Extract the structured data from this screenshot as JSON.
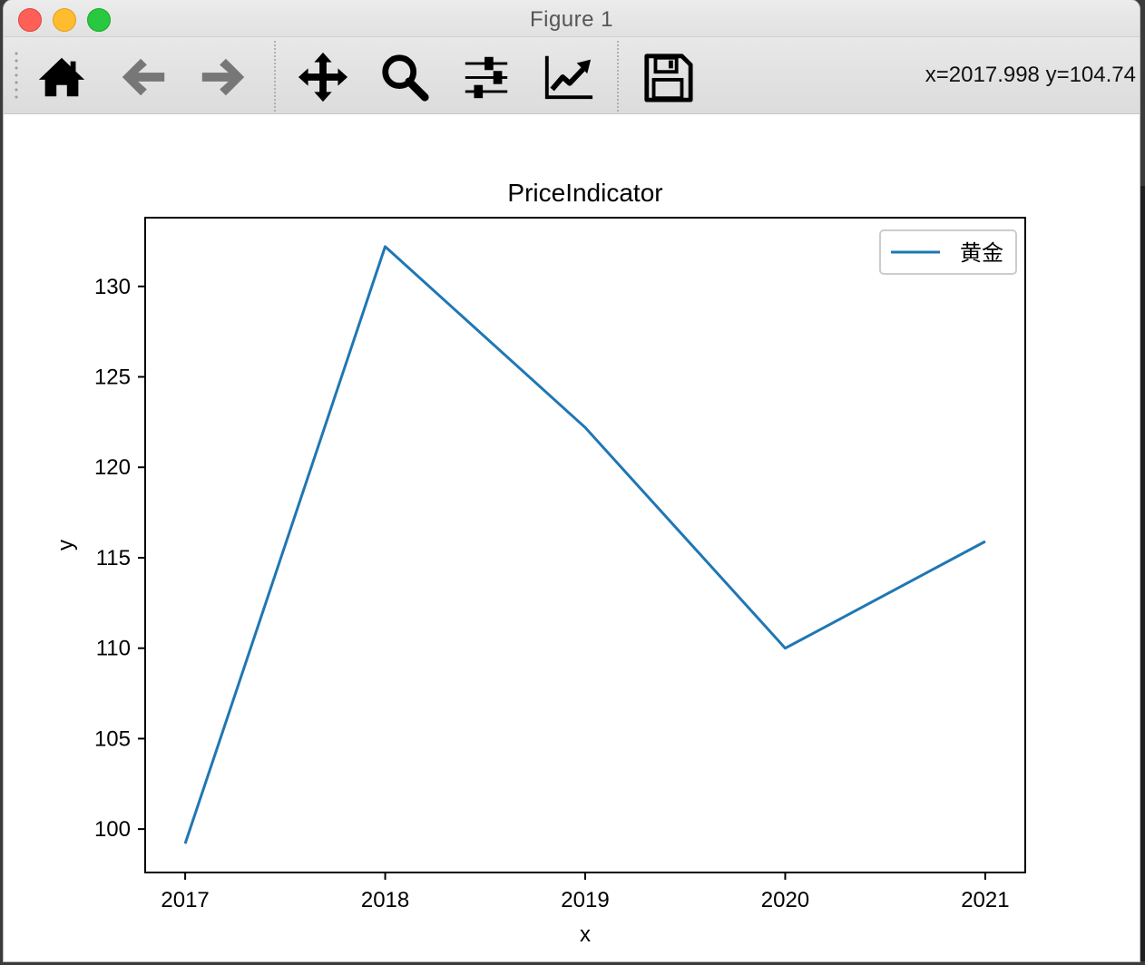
{
  "window": {
    "title": "Figure 1"
  },
  "toolbar": {
    "buttons": [
      {
        "name": "home",
        "icon": "home-icon"
      },
      {
        "name": "back",
        "icon": "arrow-left-icon"
      },
      {
        "name": "forward",
        "icon": "arrow-right-icon"
      },
      {
        "name": "pan",
        "icon": "move-icon"
      },
      {
        "name": "zoom",
        "icon": "magnifier-icon"
      },
      {
        "name": "subplots",
        "icon": "sliders-icon"
      },
      {
        "name": "edit-curves",
        "icon": "line-chart-icon"
      },
      {
        "name": "save",
        "icon": "floppy-disk-icon"
      }
    ],
    "coords": "x=2017.998 y=104.74"
  },
  "colors": {
    "line": "#1f77b4",
    "axes": "#000000"
  },
  "chart_data": {
    "type": "line",
    "title": "PriceIndicator",
    "xlabel": "x",
    "ylabel": "y",
    "x": [
      2017,
      2018,
      2019,
      2020,
      2021
    ],
    "series": [
      {
        "name": "黄金",
        "values": [
          99.2,
          132.2,
          122.2,
          110.0,
          115.9
        ]
      }
    ],
    "xlim": [
      2016.8,
      2021.2
    ],
    "ylim": [
      97.6,
      133.8
    ],
    "xticks": [
      "2017",
      "2018",
      "2019",
      "2020",
      "2021"
    ],
    "yticks": [
      "100",
      "105",
      "110",
      "115",
      "120",
      "125",
      "130"
    ],
    "legend": "upper right",
    "grid": false
  }
}
